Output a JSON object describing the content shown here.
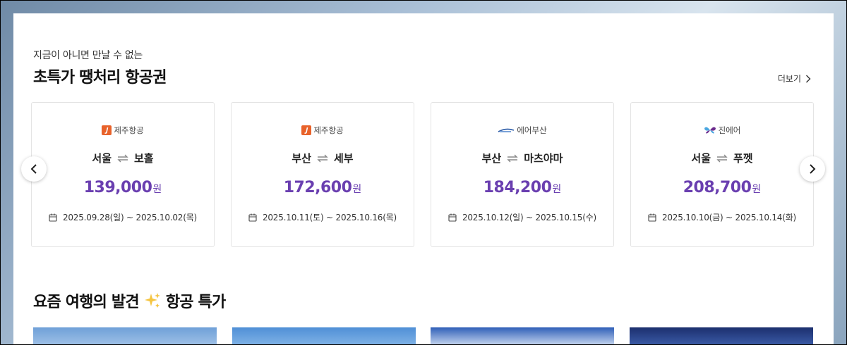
{
  "header": {
    "subtitle": "지금이 아니면 만날 수 없는",
    "title": "초특가 땡처리 항공권",
    "more_label": "더보기"
  },
  "deals": [
    {
      "airline": "제주항공",
      "logo": "jeju-air-logo",
      "origin": "서울",
      "destination": "보홀",
      "price": "139,000",
      "currency": "원",
      "dates": "2025.09.28(일) ~ 2025.10.02(목)"
    },
    {
      "airline": "제주항공",
      "logo": "jeju-air-logo",
      "origin": "부산",
      "destination": "세부",
      "price": "172,600",
      "currency": "원",
      "dates": "2025.10.11(토) ~ 2025.10.16(목)"
    },
    {
      "airline": "에어부산",
      "logo": "air-busan-logo",
      "origin": "부산",
      "destination": "마츠야마",
      "price": "184,200",
      "currency": "원",
      "dates": "2025.10.12(일) ~ 2025.10.15(수)"
    },
    {
      "airline": "진에어",
      "logo": "jin-air-logo",
      "origin": "서울",
      "destination": "푸껫",
      "price": "208,700",
      "currency": "원",
      "dates": "2025.10.10(금) ~ 2025.10.14(화)"
    }
  ],
  "section2": {
    "title_prefix": "요즘 여행의 발견",
    "title_suffix": "항공 특가",
    "emoji": "sparkles-icon"
  },
  "colors": {
    "price": "#6a3fb0",
    "jeju_air": "#e8622a",
    "air_busan": "#2d5da8",
    "jin_air": "#6a2a8c"
  }
}
